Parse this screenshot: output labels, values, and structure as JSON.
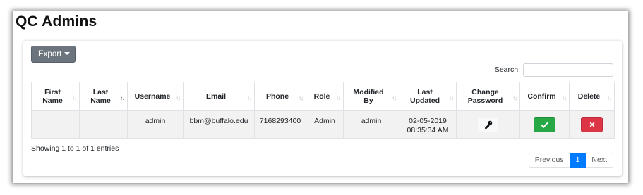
{
  "page": {
    "title": "QC Admins"
  },
  "toolbar": {
    "export_label": "Export"
  },
  "search": {
    "label": "Search:",
    "value": "",
    "placeholder": ""
  },
  "table": {
    "headers": [
      {
        "line1": "First",
        "line2": "Name",
        "sort": "none"
      },
      {
        "line1": "Last",
        "line2": "Name",
        "sort": "asc"
      },
      {
        "line1": "Username",
        "line2": "",
        "sort": "none"
      },
      {
        "line1": "Email",
        "line2": "",
        "sort": "none"
      },
      {
        "line1": "Phone",
        "line2": "",
        "sort": "none"
      },
      {
        "line1": "Role",
        "line2": "",
        "sort": "none"
      },
      {
        "line1": "Modified",
        "line2": "By",
        "sort": "none"
      },
      {
        "line1": "Last",
        "line2": "Updated",
        "sort": "none"
      },
      {
        "line1": "Change",
        "line2": "Password",
        "sort": "none"
      },
      {
        "line1": "Confirm",
        "line2": "",
        "sort": "none"
      },
      {
        "line1": "Delete",
        "line2": "",
        "sort": "none"
      }
    ],
    "rows": [
      {
        "first_name": "",
        "last_name": "",
        "username": "admin",
        "email": "bbm@buffalo.edu",
        "phone": "7168293400",
        "role": "Admin",
        "modified_by": "admin",
        "last_updated_date": "02-05-2019",
        "last_updated_time": "08:35:34 AM",
        "change_password_icon": "key-icon",
        "confirm_icon": "check-icon",
        "delete_icon": "close-icon"
      }
    ]
  },
  "footer": {
    "info": "Showing 1 to 1 of 1 entries"
  },
  "pagination": {
    "previous": "Previous",
    "current": "1",
    "next": "Next"
  },
  "colors": {
    "confirm": "#28a745",
    "delete": "#dc3545",
    "active_page": "#007bff",
    "export": "#6c757d"
  }
}
